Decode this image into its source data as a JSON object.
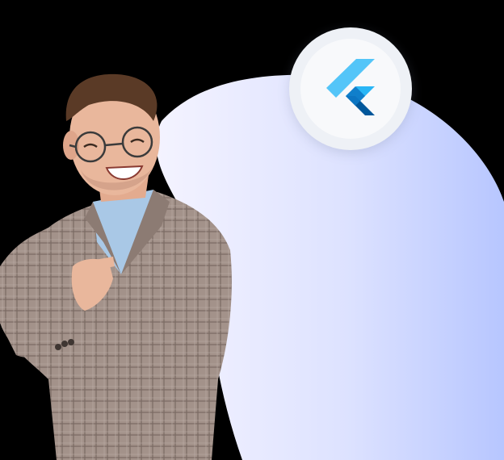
{
  "logo": {
    "icon": "flutter-logo-icon",
    "colors": {
      "light": "#54c5f8",
      "mid": "#29b6f6",
      "dark": "#01579b"
    }
  },
  "background": {
    "page": "#000000",
    "blob_gradient": [
      "#f3f2ff",
      "#dfe3ff",
      "#b9c8ff"
    ]
  },
  "person": {
    "icon": "smiling-man-pointing-image",
    "jacket": "#9c8b82",
    "shirt": "#a9c8e6",
    "skin": "#e9b79c",
    "hair": "#5a3a26"
  }
}
